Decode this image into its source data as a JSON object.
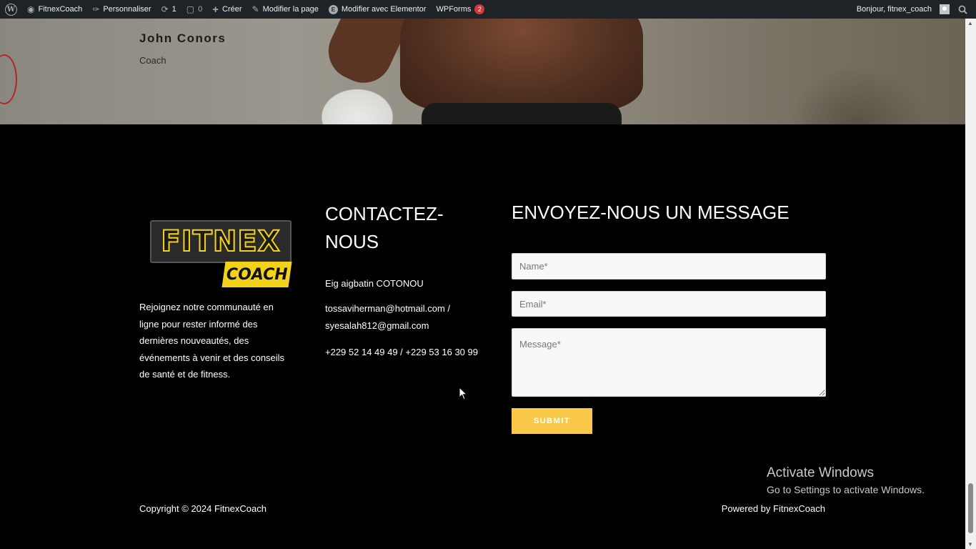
{
  "adminbar": {
    "site_name": "FitnexCoach",
    "customize": "Personnaliser",
    "updates_count": "1",
    "comments_count": "0",
    "new": "Créer",
    "edit_page": "Modifier la page",
    "elementor": "Modifier avec Elementor",
    "wpforms": "WPForms",
    "wpforms_badge": "2",
    "greeting": "Bonjour, fitnex_coach"
  },
  "hero": {
    "coach_name": "John Conors",
    "coach_role": "Coach"
  },
  "footer": {
    "logo": {
      "main": "FITNEX",
      "tag": "COACH"
    },
    "about": "Rejoignez notre communauté en ligne pour rester informé des dernières nouveautés, des événements à venir et des conseils de santé et de fitness.",
    "contact": {
      "title": "CONTACTEZ-NOUS",
      "address": "Eig aigbatin COTONOU",
      "emails": "tossaviherman@hotmail.com / syesalah812@gmail.com",
      "phones": "+229 52 14 49 49 / +229 53 16 30 99"
    },
    "form": {
      "title": "ENVOYEZ-NOUS UN MESSAGE",
      "name_placeholder": "Name*",
      "email_placeholder": "Email*",
      "message_placeholder": "Message*",
      "submit_label": "SUBMIT"
    },
    "copyright": "Copyright © 2024 FitnexCoach",
    "powered": "Powered by FitnexCoach"
  },
  "windows_watermark": {
    "line1": "Activate Windows",
    "line2": "Go to Settings to activate Windows."
  },
  "colors": {
    "adminbar_bg": "#1d2327",
    "footer_bg": "#000000",
    "submit_bg": "#fac94a",
    "logo_yellow": "#f2d21b"
  }
}
